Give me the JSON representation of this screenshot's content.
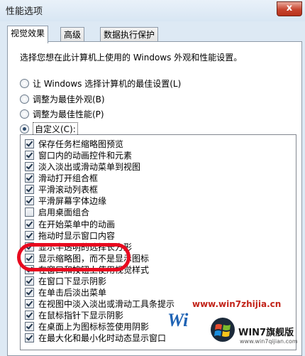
{
  "window": {
    "title": "性能选项",
    "close_label": "x"
  },
  "tabs": [
    {
      "label": "视觉效果"
    },
    {
      "label": "高级"
    },
    {
      "label": "数据执行保护"
    }
  ],
  "description": "选择您想在此计算机上使用的 Windows 外观和性能设置。",
  "radio_options": [
    {
      "label": "让 Windows 选择计算机的最佳设置(L)",
      "checked": false
    },
    {
      "label": "调整为最佳外观(B)",
      "checked": false
    },
    {
      "label": "调整为最佳性能(P)",
      "checked": false
    },
    {
      "label": "自定义(C):",
      "checked": true
    }
  ],
  "effects": [
    {
      "label": "保存任务栏缩略图预览",
      "checked": true
    },
    {
      "label": "窗口内的动画控件和元素",
      "checked": true
    },
    {
      "label": "淡入淡出或滑动菜单到视图",
      "checked": true
    },
    {
      "label": "滑动打开组合框",
      "checked": true
    },
    {
      "label": "平滑滚动列表框",
      "checked": true
    },
    {
      "label": "平滑屏幕字体边缘",
      "checked": true
    },
    {
      "label": "启用桌面组合",
      "checked": false
    },
    {
      "label": "在开始菜单中的动画",
      "checked": true
    },
    {
      "label": "拖动时显示窗口内容",
      "checked": true
    },
    {
      "label": "显示半透明的选择长方形",
      "checked": true
    },
    {
      "label": "显示缩略图，而不是显示图标",
      "checked": true
    },
    {
      "label": "在窗口和按钮上使用视觉样式",
      "checked": true
    },
    {
      "label": "在窗口下显示阴影",
      "checked": true
    },
    {
      "label": "在单击后淡出菜单",
      "checked": true
    },
    {
      "label": "在视图中淡入淡出或滑动工具条提示",
      "checked": true
    },
    {
      "label": "在鼠标指针下显示阴影",
      "checked": true
    },
    {
      "label": "在桌面上为图标标签使用阴影",
      "checked": true
    },
    {
      "label": "在最大化和最小化时动态显示窗口",
      "checked": true
    }
  ],
  "watermark": {
    "url": "www.win7zhijia.cn",
    "big_text": "Wi",
    "logo_text": "WIN7旗舰版",
    "logo_sub": "www.win7qijian.com",
    "highlight_color": "#e8091f"
  }
}
